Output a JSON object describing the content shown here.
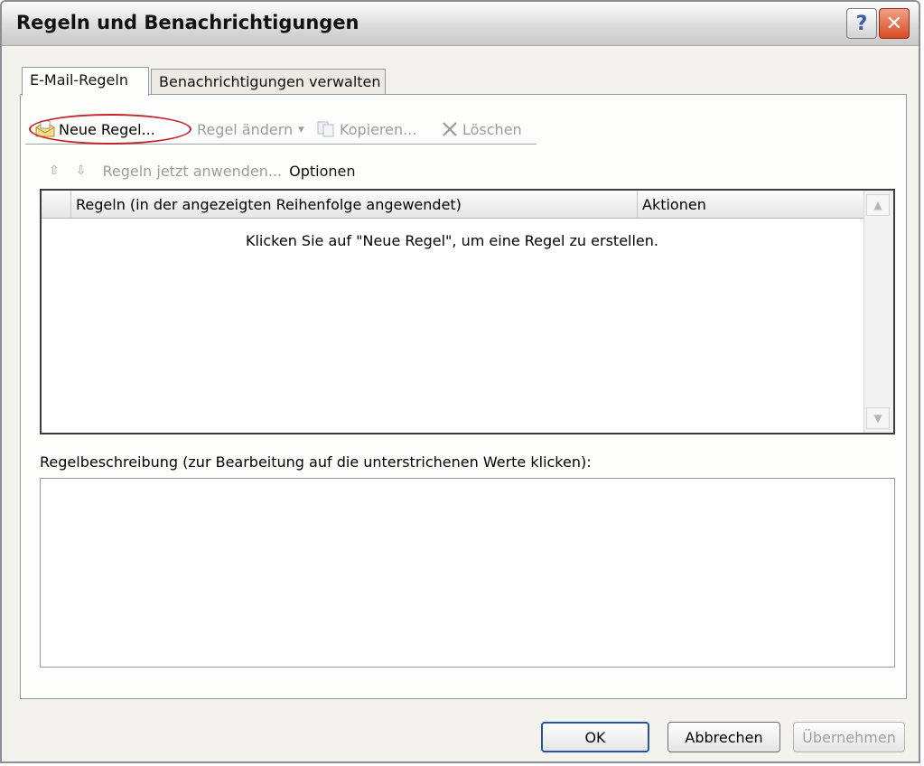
{
  "window": {
    "title": "Regeln und Benachrichtigungen",
    "help_button": "?",
    "close_button": "✕"
  },
  "tabs": [
    {
      "label": "E-Mail-Regeln",
      "active": true
    },
    {
      "label": "Benachrichtigungen verwalten",
      "active": false
    }
  ],
  "toolbar": {
    "new_rule": "Neue Regel...",
    "change_rule": "Regel ändern",
    "change_caret": "▾",
    "copy": "Kopieren...",
    "delete": "Löschen",
    "move_up": "⇧",
    "move_down": "⇩",
    "apply_now": "Regeln jetzt anwenden...",
    "options": "Optionen"
  },
  "rules_list": {
    "columns": [
      "Regeln (in der angezeigten Reihenfolge angewendet)",
      "Aktionen"
    ],
    "empty_message": "Klicken Sie auf \"Neue Regel\", um eine Regel zu erstellen.",
    "scroll_up": "▲",
    "scroll_down": "▼"
  },
  "description": {
    "label": "Regelbeschreibung (zur Bearbeitung auf die unterstrichenen Werte klicken):"
  },
  "buttons": {
    "ok": "OK",
    "cancel": "Abbrechen",
    "apply": "Übernehmen"
  },
  "colors": {
    "highlight_outline": "#c1272d",
    "title_bar": "#dcdcdc",
    "close_button": "#d84b22"
  }
}
